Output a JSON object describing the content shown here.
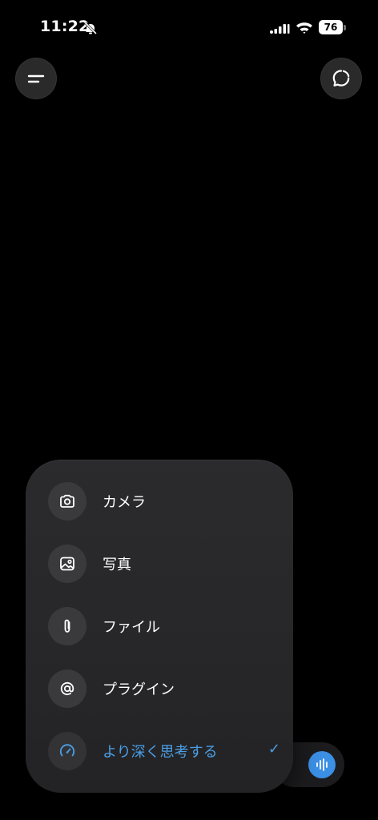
{
  "status_bar": {
    "time": "11:22",
    "battery": "76"
  },
  "menu": {
    "items": [
      {
        "label": "カメラ",
        "icon": "camera-icon"
      },
      {
        "label": "写真",
        "icon": "photo-icon"
      },
      {
        "label": "ファイル",
        "icon": "paperclip-icon"
      },
      {
        "label": "プラグイン",
        "icon": "at-sign-icon"
      },
      {
        "label": "より深く思考する",
        "icon": "gauge-icon",
        "selected": true
      }
    ],
    "check": "✓"
  },
  "colors": {
    "accent": "#4a9fe6",
    "background": "#000000",
    "panel": "#262628"
  }
}
